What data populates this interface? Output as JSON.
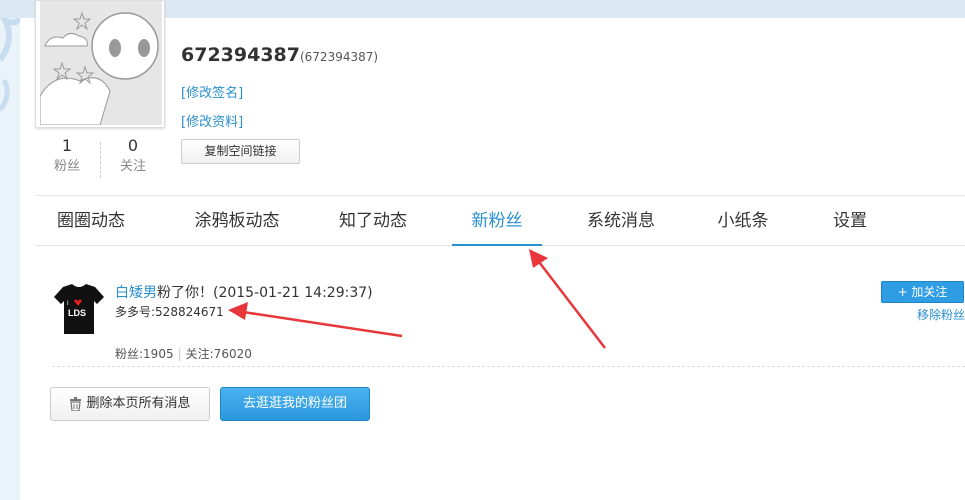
{
  "profile": {
    "uid": "672394387",
    "uid_paren": "(672394387)",
    "edit_signature": "[修改签名]",
    "edit_profile": "[修改资料]",
    "copy_link": "复制空间链接",
    "fans_count": "1",
    "fans_label": "粉丝",
    "following_count": "0",
    "following_label": "关注"
  },
  "tabs": [
    {
      "label": "圈圈动态"
    },
    {
      "label": "涂鸦板动态"
    },
    {
      "label": "知了动态"
    },
    {
      "label": "新粉丝"
    },
    {
      "label": "系统消息"
    },
    {
      "label": "小纸条"
    },
    {
      "label": "设置"
    }
  ],
  "active_tab": "新粉丝",
  "fan": {
    "name": "白矮男",
    "action": "粉了你！",
    "time": "(2015-01-21 14:29:37)",
    "id_label": "多多号:528824671",
    "fans": "粉丝:1905",
    "following": "关注:76020",
    "follow_button": "+ 加关注",
    "remove_link": "移除粉丝",
    "avatar_text": "LDS"
  },
  "actions": {
    "delete_all": "删除本页所有消息",
    "fan_club": "去逛逛我的粉丝团"
  },
  "colors": {
    "accent": "#2a8fcf",
    "annotation_arrow": "#e8373a"
  }
}
